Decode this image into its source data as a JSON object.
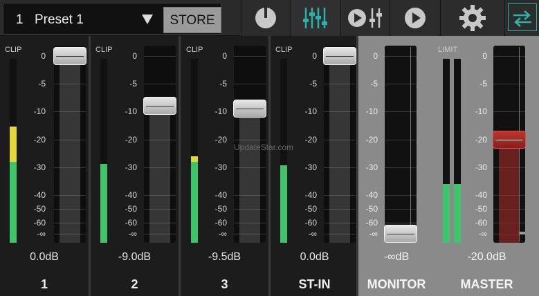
{
  "preset": {
    "number": "1",
    "name": "Preset 1",
    "store_label": "STORE"
  },
  "toolbar": [
    "power-icon",
    "mixer-faders-icon",
    "play-and-faders-icon",
    "play-icon",
    "gear-icon",
    "swap-arrows-icon"
  ],
  "watermark": "UpdateStar.com",
  "scale": [
    "0",
    "-5",
    "-10",
    "-20",
    "-30",
    "-40",
    "-50",
    "-60",
    "-∞"
  ],
  "channels": [
    {
      "name": "1",
      "clip": "CLIP",
      "db": "0.0dB",
      "fader_db": 0,
      "meter_levels": [
        0.63
      ]
    },
    {
      "name": "2",
      "clip": "CLIP",
      "db": "-9.0dB",
      "fader_db": -9,
      "meter_levels": [
        0.43
      ]
    },
    {
      "name": "3",
      "clip": "CLIP",
      "db": "-9.5dB",
      "fader_db": -9.5,
      "meter_levels": [
        0.47
      ]
    },
    {
      "name": "ST-IN",
      "clip": "CLIP",
      "db": "0.0dB",
      "fader_db": 0,
      "meter_levels": [
        0.42
      ]
    },
    {
      "name": "MONITOR",
      "clip": "",
      "db": "-∞dB",
      "fader_db": "-∞",
      "meter_levels": []
    },
    {
      "name": "MASTER",
      "clip": "LIMIT",
      "db": "-20.0dB",
      "fader_db": -20,
      "meter_levels": [
        0.32,
        0.32
      ]
    }
  ],
  "colors": {
    "meter_green": "#3fc46a",
    "meter_yellow": "#e4d63a",
    "accent_teal": "#2ab3a8",
    "master_red": "#b0302a"
  }
}
